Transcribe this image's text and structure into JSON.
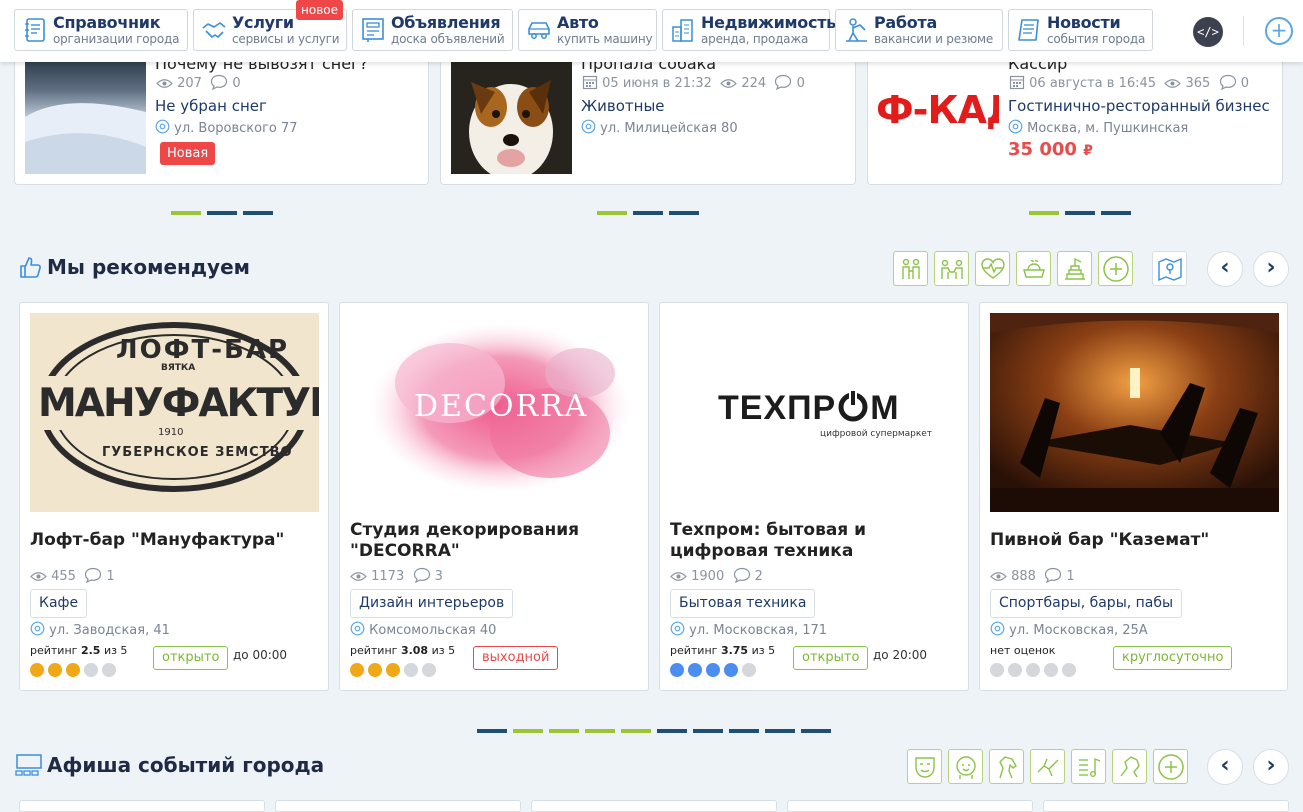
{
  "nav": {
    "items": [
      {
        "title": "Справочник",
        "sub": "организации города"
      },
      {
        "title": "Услуги",
        "sub": "сервисы и услуги"
      },
      {
        "title": "Объявления",
        "sub": "доска объявлений"
      },
      {
        "title": "Авто",
        "sub": "купить машину"
      },
      {
        "title": "Недвижимость",
        "sub": "аренда, продажа"
      },
      {
        "title": "Работа",
        "sub": "вакансии и резюме"
      },
      {
        "title": "Новости",
        "sub": "события города"
      }
    ],
    "new_badge": "новое",
    "code_icon": "</>",
    "plus_icon": "+"
  },
  "ads": [
    {
      "title": "Почему не вывозят снег?",
      "views": "207",
      "comments": "0",
      "category": "Не убран снег",
      "address": "ул. Воровского 77",
      "tag": "Новая"
    },
    {
      "title": "Пропала собака",
      "date": "05 июня в 21:32",
      "views": "224",
      "comments": "0",
      "category": "Животные",
      "address": "ул. Милицейская 80"
    },
    {
      "title": "Кассир",
      "date": "06 августа в 16:45",
      "views": "365",
      "comments": "0",
      "category": "Гостинично-ресторанный бизнес",
      "address": "Москва, м. Пушкинская",
      "price": "35 000",
      "currency": "₽",
      "logo_text": "Ф-КАД"
    }
  ],
  "recommend": {
    "title": "Мы рекомендуем",
    "arrows": {
      "prev": "‹",
      "next": "›"
    },
    "cards": [
      {
        "name": "Лофт-бар \"Мануфактура\"",
        "views": "455",
        "comments": "1",
        "category": "Кафе",
        "address": "ул. Заводская, 41",
        "rating_label": "рейтинг",
        "rating": "2.5",
        "rating_of": "из 5",
        "status": "открыто",
        "hours": "до 00:00",
        "logo_top": "ЛОФТ-БАР",
        "logo_mid": "МАНУФАКТУРА",
        "logo_small": "ВЯТКА",
        "logo_year": "1910",
        "logo_bottom": "ГУБЕРНСКОЕ ЗЕМСТВО"
      },
      {
        "name": "Студия декорирования \"DECORRA\"",
        "views": "1173",
        "comments": "3",
        "category": "Дизайн интерьеров",
        "address": "Комсомольская 40",
        "rating_label": "рейтинг",
        "rating": "3.08",
        "rating_of": "из 5",
        "status": "выходной",
        "logo_text": "DECORRA"
      },
      {
        "name": "Техпром: бытовая и цифровая техника",
        "views": "1900",
        "comments": "2",
        "category": "Бытовая техника",
        "address": "ул. Московская, 171",
        "rating_label": "рейтинг",
        "rating": "3.75",
        "rating_of": "из 5",
        "status": "открыто",
        "hours": "до 20:00",
        "logo_text": "ТЕХПР",
        "logo_text_end": "М",
        "logo_sub": "цифровой супермаркет"
      },
      {
        "name": "Пивной бар \"Каземат\"",
        "views": "888",
        "comments": "1",
        "category": "Спортбары, бары, пабы",
        "address": "ул. Московская, 25А",
        "rating_label": "нет оценок",
        "status": "круглосуточно"
      }
    ]
  },
  "events": {
    "title": "Афиша событий города",
    "arrows": {
      "prev": "‹",
      "next": "›"
    }
  },
  "colors": {
    "accent_green": "#9bc534",
    "navy": "#1f4f73",
    "red": "#ef4747",
    "rating_orange": "#f0a818",
    "rating_blue": "#4b8ef0"
  }
}
